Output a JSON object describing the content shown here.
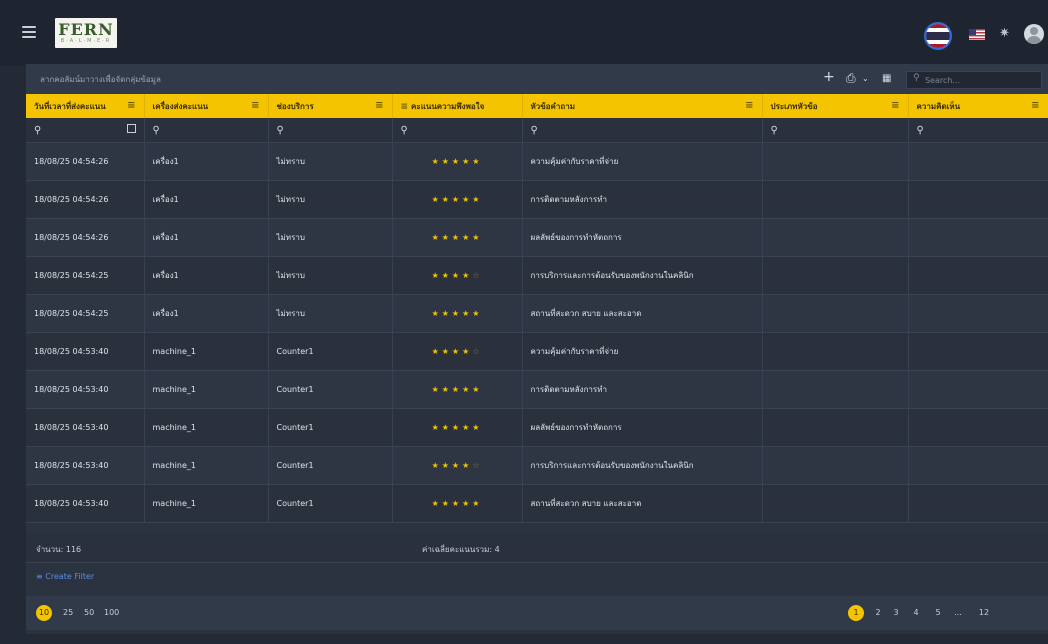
{
  "header": {
    "logo_text": "FERN",
    "logo_sub": "B·A·L·M·E·R"
  },
  "toolbar": {
    "group_hint": "ลากคอลัมน์มาวางเพื่อจัดกลุ่มข้อมูล",
    "search_placeholder": "Search..."
  },
  "columns": [
    "วันที่เวลาที่ส่งคะแนน",
    "เครื่องส่งคะแนน",
    "ช่องบริการ",
    "คะแนนความพึงพอใจ",
    "หัวข้อคำถาม",
    "ประเภทหัวข้อ",
    "ความคิดเห็น"
  ],
  "rows": [
    {
      "datetime": "18/08/25 04:54:26",
      "machine": "เครื่อง1",
      "channel": "ไม่ทราบ",
      "rating": 5,
      "topic": "ความคุ้มค่ากับราคาที่จ่าย",
      "category": "",
      "comment": ""
    },
    {
      "datetime": "18/08/25 04:54:26",
      "machine": "เครื่อง1",
      "channel": "ไม่ทราบ",
      "rating": 5,
      "topic": "การติดตามหลังการทำ",
      "category": "",
      "comment": ""
    },
    {
      "datetime": "18/08/25 04:54:26",
      "machine": "เครื่อง1",
      "channel": "ไม่ทราบ",
      "rating": 5,
      "topic": "ผลลัพธ์ของการทำหัตถการ",
      "category": "",
      "comment": ""
    },
    {
      "datetime": "18/08/25 04:54:25",
      "machine": "เครื่อง1",
      "channel": "ไม่ทราบ",
      "rating": 4,
      "topic": "การบริการและการต้อนรับของพนักงานในคลินิก",
      "category": "",
      "comment": ""
    },
    {
      "datetime": "18/08/25 04:54:25",
      "machine": "เครื่อง1",
      "channel": "ไม่ทราบ",
      "rating": 5,
      "topic": "สถานที่สะดวก สบาย และสะอาด",
      "category": "",
      "comment": ""
    },
    {
      "datetime": "18/08/25 04:53:40",
      "machine": "machine_1",
      "channel": "Counter1",
      "rating": 4,
      "topic": "ความคุ้มค่ากับราคาที่จ่าย",
      "category": "",
      "comment": ""
    },
    {
      "datetime": "18/08/25 04:53:40",
      "machine": "machine_1",
      "channel": "Counter1",
      "rating": 5,
      "topic": "การติดตามหลังการทำ",
      "category": "",
      "comment": ""
    },
    {
      "datetime": "18/08/25 04:53:40",
      "machine": "machine_1",
      "channel": "Counter1",
      "rating": 5,
      "topic": "ผลลัพธ์ของการทำหัตถการ",
      "category": "",
      "comment": ""
    },
    {
      "datetime": "18/08/25 04:53:40",
      "machine": "machine_1",
      "channel": "Counter1",
      "rating": 4,
      "topic": "การบริการและการต้อนรับของพนักงานในคลินิก",
      "category": "",
      "comment": ""
    },
    {
      "datetime": "18/08/25 04:53:40",
      "machine": "machine_1",
      "channel": "Counter1",
      "rating": 5,
      "topic": "สถานที่สะดวก สบาย และสะอาด",
      "category": "",
      "comment": ""
    }
  ],
  "footer": {
    "count_label": "จำนวน: 116",
    "avg_label": "ค่าเฉลี่ยคะแนนรวม: 4",
    "create_filter": "Create Filter"
  },
  "pager": {
    "page_sizes": [
      "10",
      "25",
      "50",
      "100"
    ],
    "active_size": "10",
    "pages": [
      "1",
      "2",
      "3",
      "4",
      "5",
      "...",
      "12"
    ],
    "active_page": "1"
  },
  "colors": {
    "accent": "#f5c400",
    "background": "#232a36",
    "link": "#5b8de0"
  }
}
